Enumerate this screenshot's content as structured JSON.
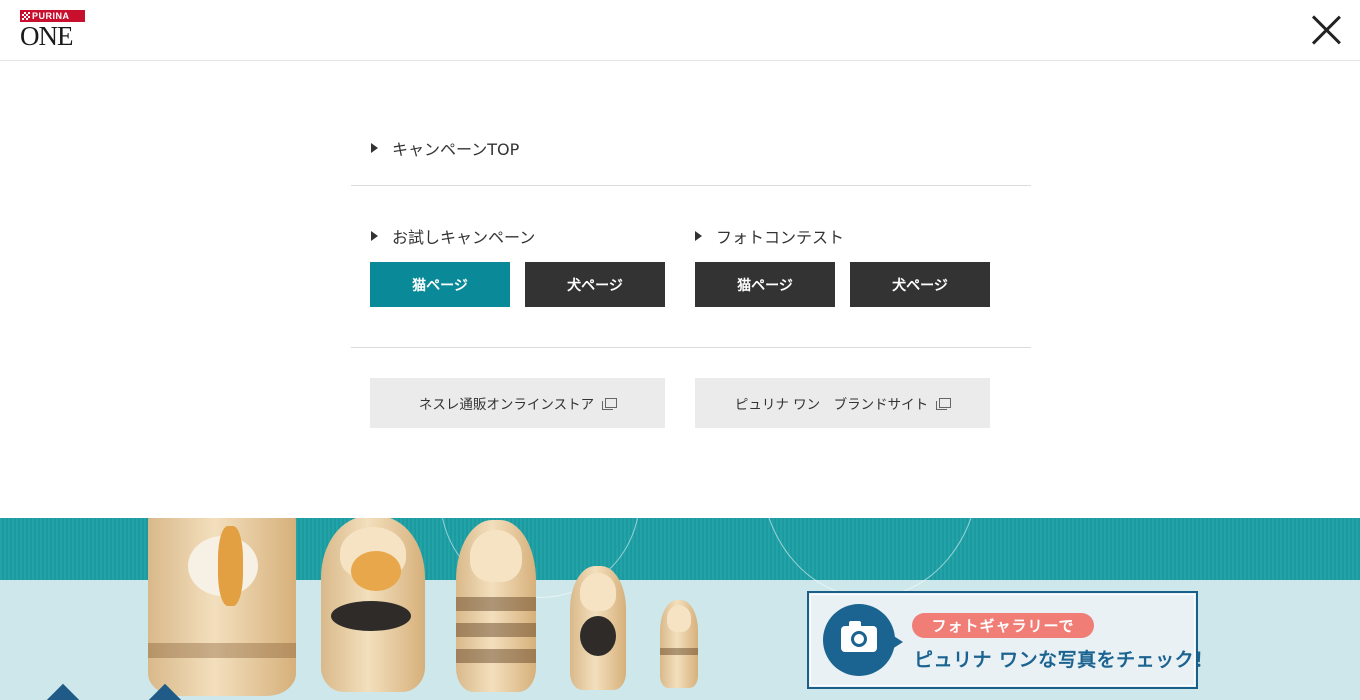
{
  "header": {
    "logo_top": "PURINA",
    "logo_main": "ONE",
    "close_icon": "close-icon"
  },
  "menu": {
    "campaign_top": "キャンペーンTOP",
    "trial_campaign": {
      "label": "お試しキャンペーン",
      "cat_page": "猫ページ",
      "dog_page": "犬ページ"
    },
    "photo_contest": {
      "label": "フォトコンテスト",
      "cat_page": "猫ページ",
      "dog_page": "犬ページ"
    },
    "external_links": [
      {
        "label": "ネスレ通販オンラインストア",
        "icon": "external-link-icon"
      },
      {
        "label": "ピュリナ ワン　ブランドサイト",
        "icon": "external-link-icon"
      }
    ],
    "active_color": "#0a8a98",
    "button_color": "#333333"
  },
  "gallery_banner": {
    "pill_text": "フォトギャラリーで",
    "main_text": "ピュリナ ワンな写真をチェック！",
    "icon": "camera-icon",
    "pill_color": "#f17d77",
    "accent_color": "#1b6390"
  }
}
